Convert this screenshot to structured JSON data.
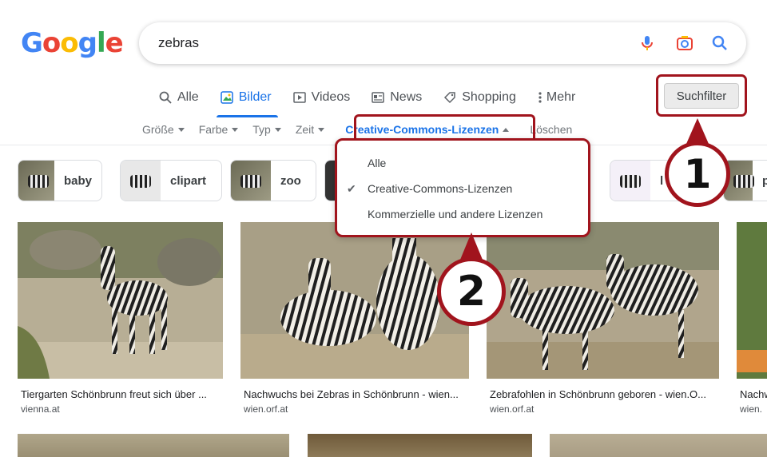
{
  "logo": [
    "G",
    "o",
    "o",
    "g",
    "l",
    "e"
  ],
  "search": {
    "value": "zebras"
  },
  "icons": {
    "mic": "mic-icon",
    "camera": "camera-icon",
    "search": "search-icon"
  },
  "tabs": [
    {
      "label": "Alle",
      "icon": "search-icon"
    },
    {
      "label": "Bilder",
      "icon": "image-icon",
      "active": true
    },
    {
      "label": "Videos",
      "icon": "play-icon"
    },
    {
      "label": "News",
      "icon": "news-icon"
    },
    {
      "label": "Shopping",
      "icon": "tag-icon"
    },
    {
      "label": "Mehr",
      "icon": "more-vert-icon"
    }
  ],
  "suchfilter": "Suchfilter",
  "filters": {
    "size": "Größe",
    "color": "Farbe",
    "type": "Typ",
    "time": "Zeit",
    "license": "Creative-Commons-Lizenzen",
    "clear": "Löschen"
  },
  "chips": [
    "baby",
    "clipart",
    "zoo",
    "d",
    "l",
    "p"
  ],
  "dropdown": {
    "items": [
      "Alle",
      "Creative-Commons-Lizenzen",
      "Kommerzielle und andere Lizenzen"
    ],
    "checked_index": 1
  },
  "badges": [
    "1",
    "2"
  ],
  "results": [
    {
      "title": "Tiergarten Schönbrunn freut sich über ...",
      "source": "vienna.at"
    },
    {
      "title": "Nachwuchs bei Zebras in Schönbrunn - wien...",
      "source": "wien.orf.at"
    },
    {
      "title": "Zebrafohlen in Schönbrunn geboren - wien.O...",
      "source": "wien.orf.at"
    },
    {
      "title": "Nachw",
      "source": "wien."
    }
  ],
  "colors": {
    "accent": "#1a73e8",
    "annotation": "#a1141d"
  }
}
